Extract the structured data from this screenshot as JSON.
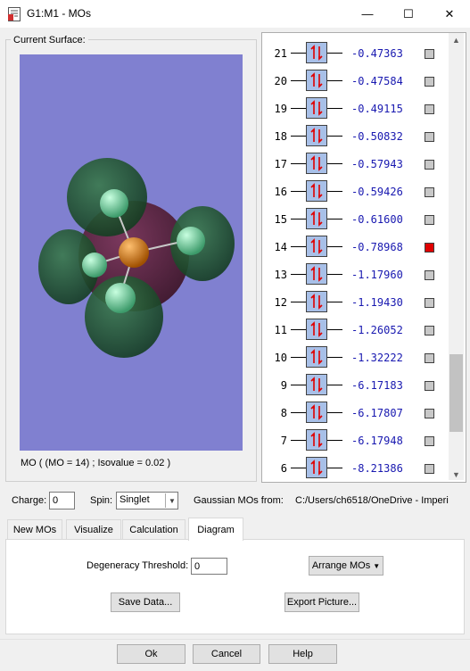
{
  "window": {
    "title": "G1:M1 - MOs",
    "minimize_glyph": "—",
    "maximize_glyph": "☐",
    "close_glyph": "✕"
  },
  "surface": {
    "group_label": "Current Surface:",
    "status": "MO ( (MO = 14) ; Isovalue = 0.02 )"
  },
  "mo_list": {
    "rows": [
      {
        "num": "21",
        "energy": "-0.47363",
        "selected": false
      },
      {
        "num": "20",
        "energy": "-0.47584",
        "selected": false
      },
      {
        "num": "19",
        "energy": "-0.49115",
        "selected": false
      },
      {
        "num": "18",
        "energy": "-0.50832",
        "selected": false
      },
      {
        "num": "17",
        "energy": "-0.57943",
        "selected": false
      },
      {
        "num": "16",
        "energy": "-0.59426",
        "selected": false
      },
      {
        "num": "15",
        "energy": "-0.61600",
        "selected": false
      },
      {
        "num": "14",
        "energy": "-0.78968",
        "selected": true
      },
      {
        "num": "13",
        "energy": "-1.17960",
        "selected": false
      },
      {
        "num": "12",
        "energy": "-1.19430",
        "selected": false
      },
      {
        "num": "11",
        "energy": "-1.26052",
        "selected": false
      },
      {
        "num": "10",
        "energy": "-1.32222",
        "selected": false
      },
      {
        "num": "9",
        "energy": "-6.17183",
        "selected": false
      },
      {
        "num": "8",
        "energy": "-6.17807",
        "selected": false
      },
      {
        "num": "7",
        "energy": "-6.17948",
        "selected": false
      },
      {
        "num": "6",
        "energy": "-8.21386",
        "selected": false
      }
    ],
    "selected_color": "#e00000",
    "unselected_color": "#c8c8c8"
  },
  "controls": {
    "charge_label": "Charge:",
    "charge_value": "0",
    "spin_label": "Spin:",
    "spin_value": "Singlet",
    "source_label": "Gaussian MOs from:",
    "source_path": "C:/Users/ch6518/OneDrive - Imperi"
  },
  "tabs": [
    {
      "label": "New MOs",
      "active": false
    },
    {
      "label": "Visualize",
      "active": false
    },
    {
      "label": "Calculation",
      "active": false
    },
    {
      "label": "Diagram",
      "active": true
    }
  ],
  "diagram": {
    "degeneracy_label": "Degeneracy Threshold:",
    "degeneracy_value": "0",
    "arrange_label": "Arrange MOs",
    "save_label": "Save Data...",
    "export_label": "Export Picture..."
  },
  "footer": {
    "ok_label": "Ok",
    "cancel_label": "Cancel",
    "help_label": "Help"
  }
}
